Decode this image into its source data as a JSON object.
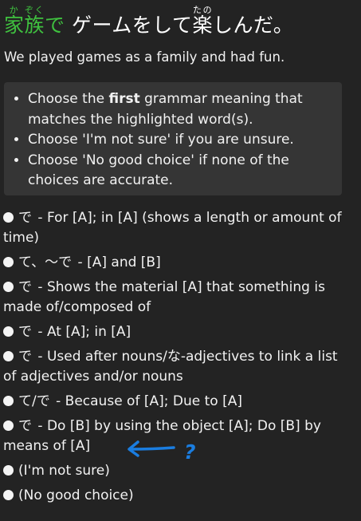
{
  "sentence": {
    "highlight_parts": [
      {
        "base": "家",
        "reading": "か"
      },
      {
        "base": "族",
        "reading": "ぞく"
      },
      {
        "base": "で",
        "reading": ""
      }
    ],
    "middle": "ゲームをして",
    "kanji2": {
      "base": "楽",
      "reading": "たの"
    },
    "end": "しんだ。"
  },
  "translation": "We played games as a family and had fun.",
  "instructions": [
    {
      "before": "Choose the ",
      "bold": "first",
      "after": " grammar meaning that matches the highlighted word(s)."
    },
    {
      "before": "Choose 'I'm not sure' if you are unsure.",
      "bold": "",
      "after": ""
    },
    {
      "before": "Choose 'No good choice' if none of the choices are accurate.",
      "bold": "",
      "after": ""
    }
  ],
  "options": [
    {
      "term": "で",
      "meaning": " - For [A]; in [A] (shows a length or amount of time)"
    },
    {
      "term": "て、〜で",
      "meaning": " - [A] and [B]"
    },
    {
      "term": "で",
      "meaning": " - Shows the material [A] that something is made of/composed of"
    },
    {
      "term": "で",
      "meaning": " - At [A]; in [A]"
    },
    {
      "term": "で",
      "meaning": " - Used after nouns/な-adjectives to link a list of adjectives and/or nouns"
    },
    {
      "term": "て/で",
      "meaning": " - Because of [A]; Due to [A]"
    },
    {
      "term": "で",
      "meaning": " - Do [B] by using the object [A]; Do [B] by means of [A]"
    },
    {
      "term": "",
      "meaning": "(I'm not sure)"
    },
    {
      "term": "",
      "meaning": "(No good choice)"
    }
  ],
  "annotation": {
    "color": "#1a7de0",
    "mark": "?"
  },
  "colors": {
    "background": "#232323",
    "highlight": "#3fc13f",
    "panel": "#353535"
  }
}
